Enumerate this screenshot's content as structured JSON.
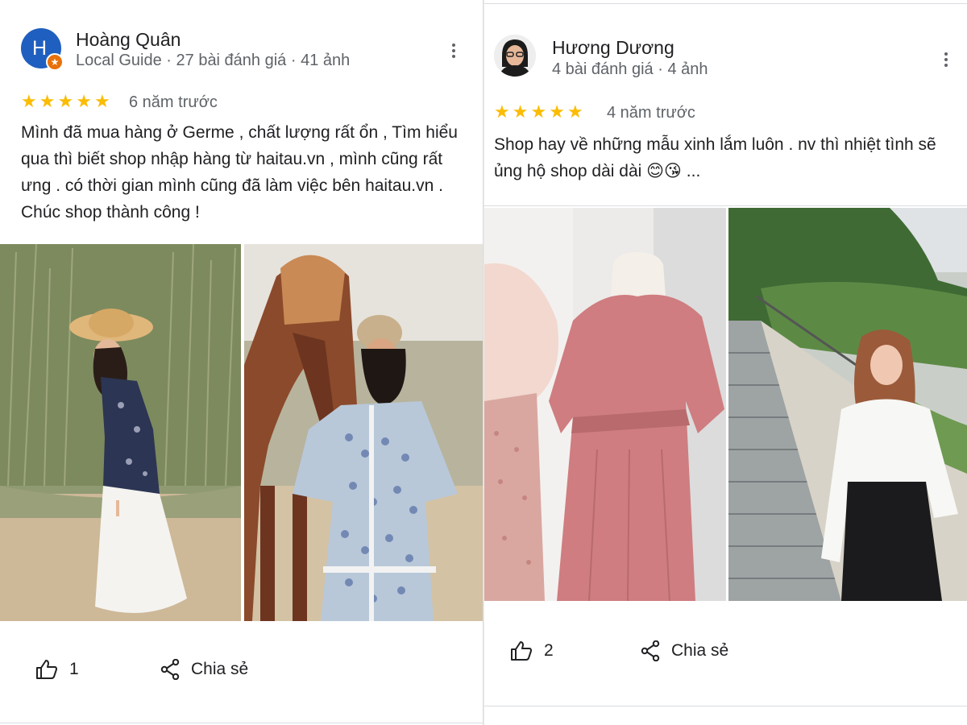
{
  "reviews": [
    {
      "author": "Hoàng Quân",
      "avatar_letter": "H",
      "avatar_color": "#1f5fbf",
      "badge_color": "#e8710a",
      "meta": "Local Guide · 27 bài đánh giá · 41 ảnh",
      "rating": 5,
      "time": "6 năm trước",
      "text": "Mình đã mua hàng ở Germe , chất lượng rất ổn , Tìm hiểu qua thì biết shop nhập hàng từ haitau.vn , mình cũng rất ưng . có thời gian mình cũng đã làm việc bên haitau.vn . Chúc shop thành công !",
      "like_count": "1",
      "share_label": "Chia sẻ",
      "photos": [
        "photo-woman-hat-grass",
        "photo-woman-with-horse"
      ]
    },
    {
      "author": "Hương Dương",
      "meta": "4 bài đánh giá · 4 ảnh",
      "rating": 5,
      "time": "4 năm trước",
      "text": "Shop hay về những mẫu xinh lắm luôn . nv thì nhiệt tình sẽ ủng hộ shop dài dài 😊😘 ...",
      "like_count": "2",
      "share_label": "Chia sẻ",
      "photos": [
        "photo-pink-dress-mannequin",
        "photo-woman-stairs-garden"
      ]
    }
  ],
  "colors": {
    "star": "#fbbc04",
    "text_secondary": "#5f6368"
  }
}
